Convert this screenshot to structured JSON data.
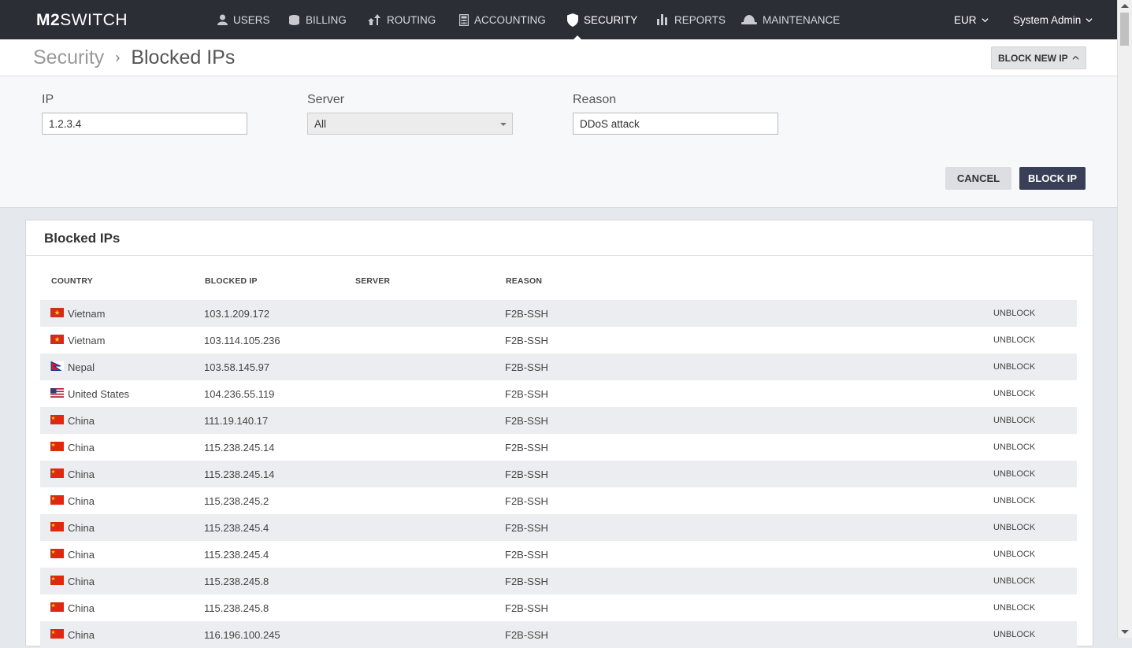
{
  "app": {
    "logo_bold": "M2",
    "logo_rest": "SWITCH"
  },
  "nav": {
    "users": "USERS",
    "billing": "BILLING",
    "routing": "ROUTING",
    "accounting": "ACCOUNTING",
    "security": "SECURITY",
    "reports": "REPORTS",
    "maintenance": "MAINTENANCE"
  },
  "topright": {
    "currency": "EUR",
    "user": "System Admin"
  },
  "breadcrumb": {
    "parent": "Security",
    "separator": "›",
    "current": "Blocked IPs"
  },
  "block_new_button": "BLOCK NEW IP",
  "form": {
    "ip_label": "IP",
    "ip_value": "1.2.3.4",
    "server_label": "Server",
    "server_value": "All",
    "reason_label": "Reason",
    "reason_value": "DDoS attack",
    "cancel": "CANCEL",
    "block": "BLOCK IP"
  },
  "table": {
    "title": "Blocked IPs",
    "headers": {
      "country": "COUNTRY",
      "ip": "BLOCKED IP",
      "server": "SERVER",
      "reason": "REASON"
    },
    "action_label": "UNBLOCK",
    "rows": [
      {
        "country": "Vietnam",
        "flag": "vn",
        "ip": "103.1.209.172",
        "server": "",
        "reason": "F2B-SSH"
      },
      {
        "country": "Vietnam",
        "flag": "vn",
        "ip": "103.114.105.236",
        "server": "",
        "reason": "F2B-SSH"
      },
      {
        "country": "Nepal",
        "flag": "np",
        "ip": "103.58.145.97",
        "server": "",
        "reason": "F2B-SSH"
      },
      {
        "country": "United States",
        "flag": "us",
        "ip": "104.236.55.119",
        "server": "",
        "reason": "F2B-SSH"
      },
      {
        "country": "China",
        "flag": "cn",
        "ip": "111.19.140.17",
        "server": "",
        "reason": "F2B-SSH"
      },
      {
        "country": "China",
        "flag": "cn",
        "ip": "115.238.245.14",
        "server": "",
        "reason": "F2B-SSH"
      },
      {
        "country": "China",
        "flag": "cn",
        "ip": "115.238.245.14",
        "server": "",
        "reason": "F2B-SSH"
      },
      {
        "country": "China",
        "flag": "cn",
        "ip": "115.238.245.2",
        "server": "",
        "reason": "F2B-SSH"
      },
      {
        "country": "China",
        "flag": "cn",
        "ip": "115.238.245.4",
        "server": "",
        "reason": "F2B-SSH"
      },
      {
        "country": "China",
        "flag": "cn",
        "ip": "115.238.245.4",
        "server": "",
        "reason": "F2B-SSH"
      },
      {
        "country": "China",
        "flag": "cn",
        "ip": "115.238.245.8",
        "server": "",
        "reason": "F2B-SSH"
      },
      {
        "country": "China",
        "flag": "cn",
        "ip": "115.238.245.8",
        "server": "",
        "reason": "F2B-SSH"
      },
      {
        "country": "China",
        "flag": "cn",
        "ip": "116.196.100.245",
        "server": "",
        "reason": "F2B-SSH"
      }
    ]
  }
}
